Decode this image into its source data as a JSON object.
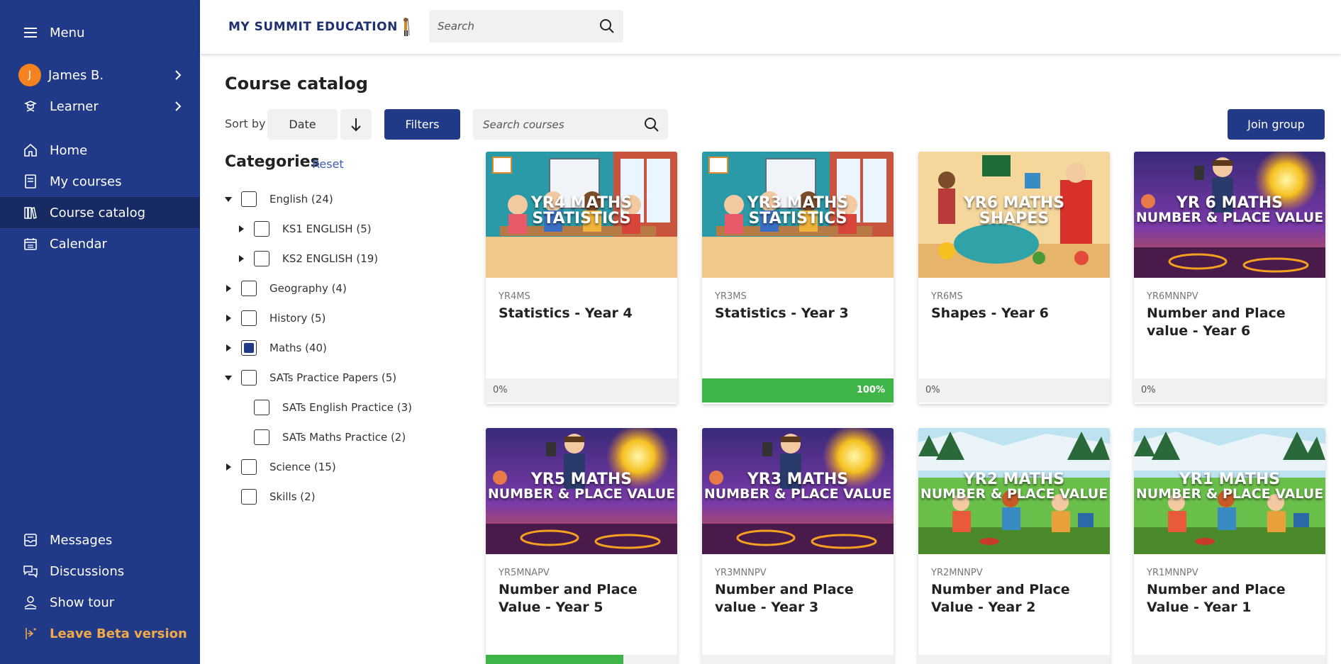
{
  "sidebar": {
    "menu_label": "Menu",
    "user_initial": "J",
    "user_name": "James B.",
    "role": "Learner",
    "nav": [
      "Home",
      "My courses",
      "Course catalog",
      "Calendar"
    ],
    "active": "Course catalog",
    "bottom": [
      "Messages",
      "Discussions",
      "Show tour"
    ],
    "beta": "Leave Beta version"
  },
  "header": {
    "logo": "MY SUMMIT EDUCATION",
    "search_placeholder": "Search"
  },
  "catalog": {
    "title": "Course catalog",
    "sort_label": "Sort by",
    "sort_value": "Date",
    "filters_label": "Filters",
    "search_placeholder": "Search courses",
    "join_label": "Join group"
  },
  "categories": {
    "title": "Categories",
    "reset": "Reset",
    "items": [
      {
        "label": "English (24)",
        "state": "expanded",
        "checked": false
      },
      {
        "label": "KS1 ENGLISH (5)",
        "state": "collapsed",
        "checked": false
      },
      {
        "label": "KS2 ENGLISH (19)",
        "state": "collapsed",
        "checked": false
      },
      {
        "label": "Geography (4)",
        "state": "collapsed",
        "checked": false
      },
      {
        "label": "History (5)",
        "state": "collapsed",
        "checked": false
      },
      {
        "label": "Maths (40)",
        "state": "collapsed",
        "checked": true
      },
      {
        "label": "SATs Practice Papers (5)",
        "state": "expanded",
        "checked": false
      },
      {
        "label": "SATs English Practice (3)",
        "state": "none",
        "checked": false
      },
      {
        "label": "SATs Maths Practice (2)",
        "state": "none",
        "checked": false
      },
      {
        "label": "Science (15)",
        "state": "collapsed",
        "checked": false
      },
      {
        "label": "Skills (2)",
        "state": "none",
        "checked": false
      }
    ]
  },
  "courses": [
    {
      "code": "YR4MS",
      "name": "Statistics - Year 4",
      "img_line1": "YR4 MATHS",
      "img_line2": "STATISTICS",
      "theme": "classroom",
      "progress": 0,
      "progress_label": "0%"
    },
    {
      "code": "YR3MS",
      "name": "Statistics - Year 3",
      "img_line1": "YR3 MATHS",
      "img_line2": "STATISTICS",
      "theme": "classroom",
      "progress": 100,
      "progress_label": "100%"
    },
    {
      "code": "YR6MS",
      "name": "Shapes - Year 6",
      "img_line1": "YR6 MATHS",
      "img_line2": "SHAPES",
      "theme": "shapes",
      "progress": 0,
      "progress_label": "0%"
    },
    {
      "code": "YR6MNNPV",
      "name": "Number and Place value - Year 6",
      "img_line1": "YR 6 MATHS",
      "img_line2": "NUMBER & PLACE VALUE",
      "theme": "space",
      "progress": 0,
      "progress_label": "0%"
    },
    {
      "code": "YR5MNAPV",
      "name": "Number and Place Value - Year 5",
      "img_line1": "YR5  MATHS",
      "img_line2": "NUMBER & PLACE VALUE",
      "theme": "space",
      "progress": 72,
      "progress_label": ""
    },
    {
      "code": "YR3MNNPV",
      "name": "Number and Place value - Year 3",
      "img_line1": "YR3  MATHS",
      "img_line2": "NUMBER & PLACE VALUE",
      "theme": "space",
      "progress": 0,
      "progress_label": ""
    },
    {
      "code": "YR2MNNPV",
      "name": "Number and Place Value - Year 2",
      "img_line1": "YR2  MATHS",
      "img_line2": "NUMBER & PLACE VALUE",
      "theme": "forest",
      "progress": 0,
      "progress_label": ""
    },
    {
      "code": "YR1MNNPV",
      "name": "Number and Place Value - Year 1",
      "img_line1": "YR1  MATHS",
      "img_line2": "NUMBER & PLACE VALUE",
      "theme": "forest",
      "progress": 0,
      "progress_label": ""
    }
  ],
  "colors": {
    "sidebar": "#213a87",
    "sidebar_active": "#172a63",
    "accent": "#213a87",
    "beta": "#f3a94a",
    "progress": "#3fb548",
    "avatar": "#f58220"
  }
}
